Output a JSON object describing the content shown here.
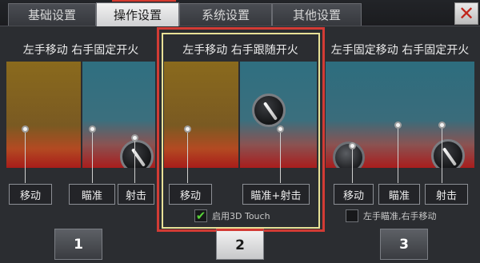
{
  "tabs": [
    {
      "label": "基础设置",
      "active": false
    },
    {
      "label": "操作设置",
      "active": true
    },
    {
      "label": "系统设置",
      "active": false
    },
    {
      "label": "其他设置",
      "active": false
    }
  ],
  "close_glyph": "✕",
  "panels": [
    {
      "title": "左手移动 右手固定开火",
      "labels": [
        "移动",
        "瞄准",
        "射击"
      ],
      "selected": false
    },
    {
      "title": "左手移动 右手跟随开火",
      "labels": [
        "移动",
        "瞄准+射击"
      ],
      "selected": true,
      "option": {
        "label": "启用3D Touch",
        "checked": true,
        "check_glyph": "✔"
      }
    },
    {
      "title": "左手固定移动 右手固定开火",
      "labels": [
        "移动",
        "瞄准",
        "射击"
      ],
      "selected": false,
      "option": {
        "label": "左手瞄准,右手移动",
        "checked": false
      }
    }
  ],
  "pages": [
    {
      "label": "1",
      "active": false
    },
    {
      "label": "2",
      "active": true
    },
    {
      "label": "3",
      "active": false
    }
  ],
  "colors": {
    "accent": "#d23b35",
    "selected_inner": "#e8e197",
    "check": "#58d238"
  },
  "icons": [
    "close-icon",
    "joystick-icon",
    "fire-knob-icon",
    "checkmark-icon"
  ]
}
